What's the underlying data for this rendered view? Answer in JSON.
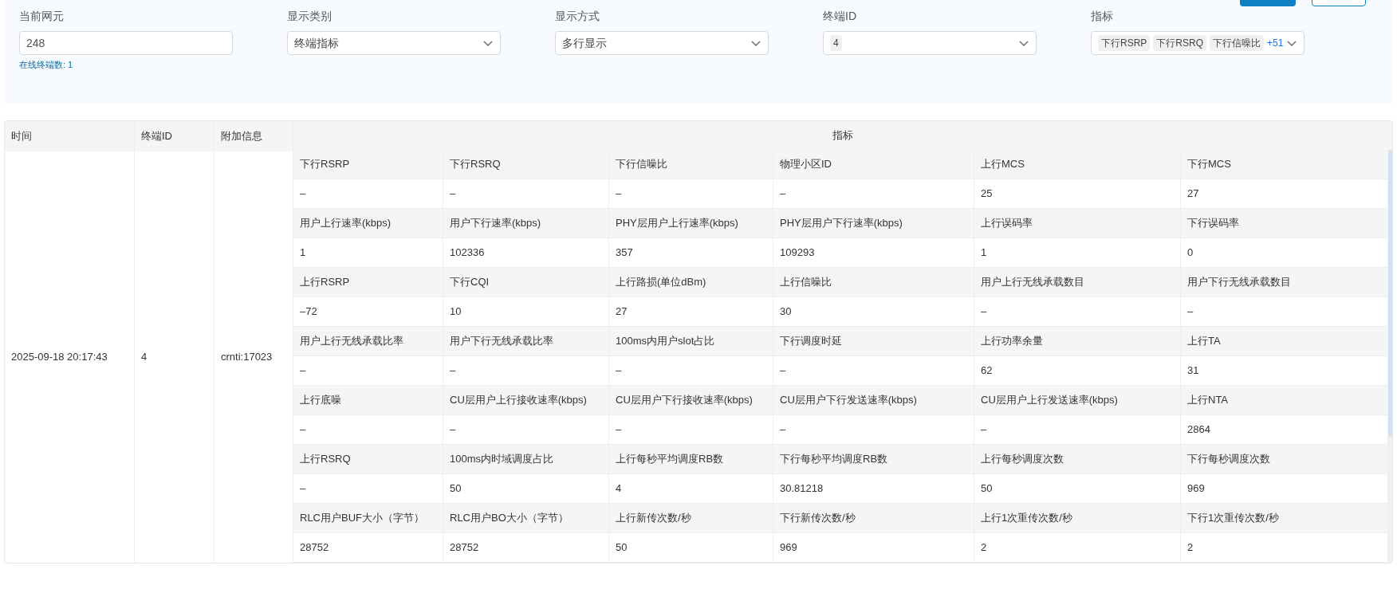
{
  "filters": [
    {
      "kind": "input",
      "label": "当前网元",
      "value": "248",
      "hint": "在线终端数: 1"
    },
    {
      "kind": "select",
      "label": "显示类别",
      "value": "终端指标"
    },
    {
      "kind": "select",
      "label": "显示方式",
      "value": "多行显示"
    },
    {
      "kind": "tags",
      "label": "终端ID",
      "tags": [
        "4"
      ]
    },
    {
      "kind": "tags",
      "label": "指标",
      "tags": [
        "下行RSRP",
        "下行RSRQ",
        "下行信噪比"
      ],
      "more": "+51"
    }
  ],
  "table": {
    "columns": [
      "时间",
      "终端ID",
      "附加信息",
      "指标"
    ],
    "row": {
      "time": "2025-09-18 20:17:43",
      "terminal_id": "4",
      "extra": "crnti:17023",
      "metrics": [
        {
          "name": "下行RSRP",
          "value": "–"
        },
        {
          "name": "下行RSRQ",
          "value": "–"
        },
        {
          "name": "下行信噪比",
          "value": "–"
        },
        {
          "name": "物理小区ID",
          "value": "–"
        },
        {
          "name": "上行MCS",
          "value": "25"
        },
        {
          "name": "下行MCS",
          "value": "27"
        },
        {
          "name": "用户上行速率(kbps)",
          "value": "1"
        },
        {
          "name": "用户下行速率(kbps)",
          "value": "102336"
        },
        {
          "name": "PHY层用户上行速率(kbps)",
          "value": "357"
        },
        {
          "name": "PHY层用户下行速率(kbps)",
          "value": "109293"
        },
        {
          "name": "上行误码率",
          "value": "1"
        },
        {
          "name": "下行误码率",
          "value": "0"
        },
        {
          "name": "上行RSRP",
          "value": "–72"
        },
        {
          "name": "下行CQI",
          "value": "10"
        },
        {
          "name": "上行路损(单位dBm)",
          "value": "27"
        },
        {
          "name": "上行信噪比",
          "value": "30"
        },
        {
          "name": "用户上行无线承载数目",
          "value": "–"
        },
        {
          "name": "用户下行无线承载数目",
          "value": "–"
        },
        {
          "name": "用户上行无线承载比率",
          "value": "–"
        },
        {
          "name": "用户下行无线承载比率",
          "value": "–"
        },
        {
          "name": "100ms内用户slot占比",
          "value": "–"
        },
        {
          "name": "下行调度时延",
          "value": "–"
        },
        {
          "name": "上行功率余量",
          "value": "62"
        },
        {
          "name": "上行TA",
          "value": "31"
        },
        {
          "name": "上行底噪",
          "value": "–"
        },
        {
          "name": "CU层用户上行接收速率(kbps)",
          "value": "–"
        },
        {
          "name": "CU层用户下行接收速率(kbps)",
          "value": "–"
        },
        {
          "name": "CU层用户下行发送速率(kbps)",
          "value": "–"
        },
        {
          "name": "CU层用户上行发送速率(kbps)",
          "value": "–"
        },
        {
          "name": "上行NTA",
          "value": "2864"
        },
        {
          "name": "上行RSRQ",
          "value": "–"
        },
        {
          "name": "100ms内时域调度占比",
          "value": "50"
        },
        {
          "name": "上行每秒平均调度RB数",
          "value": "4"
        },
        {
          "name": "下行每秒平均调度RB数",
          "value": "30.81218"
        },
        {
          "name": "上行每秒调度次数",
          "value": "50"
        },
        {
          "name": "下行每秒调度次数",
          "value": "969"
        },
        {
          "name": "RLC用户BUF大小（字节）",
          "value": "28752"
        },
        {
          "name": "RLC用户BO大小（字节）",
          "value": "28752"
        },
        {
          "name": "上行新传次数/秒",
          "value": "50"
        },
        {
          "name": "下行新传次数/秒",
          "value": "969"
        },
        {
          "name": "上行1次重传次数/秒",
          "value": "2"
        },
        {
          "name": "下行1次重传次数/秒",
          "value": "2"
        }
      ]
    }
  }
}
